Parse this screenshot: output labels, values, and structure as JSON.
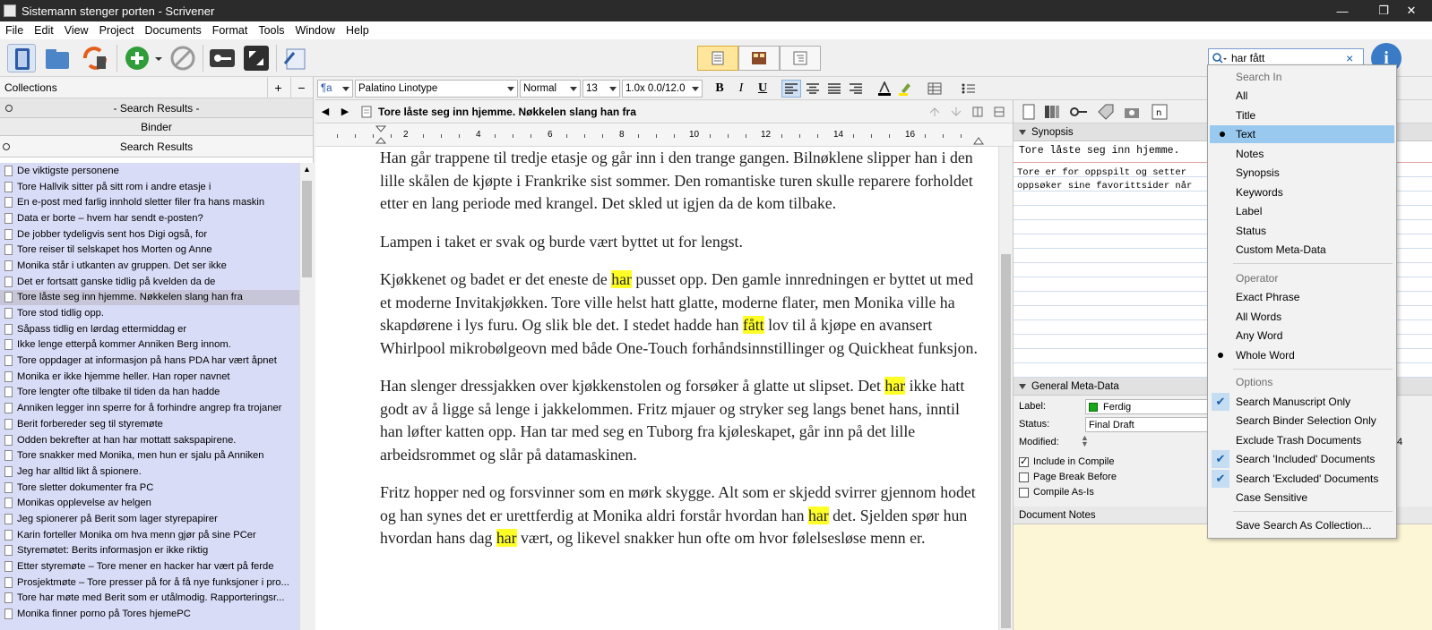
{
  "window": {
    "title": "Sistemann stenger porten - Scrivener",
    "minimize": "—",
    "maximize": "❐",
    "close": "✕"
  },
  "menu": [
    "File",
    "Edit",
    "View",
    "Project",
    "Documents",
    "Format",
    "Tools",
    "Window",
    "Help"
  ],
  "toolbar": {
    "search_value": "har fått",
    "search_clear": "×",
    "help_label": "i"
  },
  "binder": {
    "collections_label": "Collections",
    "add_label": "+",
    "remove_label": "−",
    "search_results_tab": "- Search Results -",
    "binder_tab": "Binder",
    "search_results_header": "Search Results",
    "items": [
      "De viktigste personene",
      "Tore Hallvik sitter på sitt rom i andre etasje i",
      "En e-post med farlig innhold sletter filer fra hans maskin",
      "Data er borte – hvem har sendt e-posten?",
      "De jobber tydeligvis sent hos Digi også, for",
      "Tore reiser til selskapet hos Morten og Anne",
      "Monika står i utkanten av gruppen. Det ser ikke",
      "Det er fortsatt ganske tidlig på kvelden da de",
      "Tore låste seg inn hjemme. Nøkkelen slang han fra",
      "Tore stod tidlig opp.",
      "Såpass tidlig en lørdag ettermiddag er",
      "Ikke lenge etterpå kommer Anniken Berg innom.",
      "Tore oppdager at informasjon på hans PDA har vært åpnet",
      "Monika er ikke hjemme heller. Han roper navnet",
      "Tore lengter ofte tilbake til tiden da han hadde",
      "Anniken legger inn sperre for å forhindre angrep fra trojaner",
      "Berit forbereder seg til styremøte",
      "Odden bekrefter at han har mottatt sakspapirene.",
      "Tore snakker med Monika, men hun er sjalu på Anniken",
      "Jeg har alltid likt å spionere.",
      "Tore sletter dokumenter fra PC",
      "Monikas opplevelse av helgen",
      "Jeg spionerer på Berit som lager styrepapirer",
      "Karin forteller Monika om hva menn gjør på sine PCer",
      "Styremøtet: Berits informasjon er ikke riktig",
      "Etter styremøte – Tore mener en hacker har vært på ferde",
      "Prosjektmøte – Tore presser på for å få nye funksjoner i pro...",
      "Tore har møte med Berit som er utålmodig. Rapporteringsr...",
      "Monika finner porno på Tores hjemePC"
    ]
  },
  "format": {
    "style": "¶a",
    "font": "Palatino Linotype",
    "weight": "Normal",
    "size": "13",
    "spacing": "1.0x 0.0/12.0",
    "bold": "B",
    "italic": "I",
    "underline": "U"
  },
  "editor": {
    "title": "Tore låste seg inn hjemme. Nøkkelen slang han fra",
    "ruler": [
      "2",
      "4",
      "6",
      "8",
      "10",
      "12",
      "14",
      "16"
    ],
    "p1": "Han går trappene til tredje etasje og går inn i den trange gangen. Bilnøklene slipper han i den lille skålen de kjøpte i Frankrike sist sommer. Den romantiske turen skulle reparere forholdet etter en lang periode med krangel. Det skled ut igjen da de kom tilbake.",
    "p2": "Lampen i taket er svak og burde vært byttet ut for lengst.",
    "p3a": "Kjøkkenet og badet er det eneste de ",
    "p3h1": "har",
    "p3b": " pusset opp. Den gamle innredningen er byttet ut med et moderne Invitakjøkken. Tore ville helst hatt glatte, moderne flater, men Monika ville ha skapdørene i lys furu. Og slik ble det. I stedet hadde han ",
    "p3h2": "fått",
    "p3c": " lov til å kjøpe en avansert Whirlpool mikrobølgeovn med både One-Touch forhåndsinnstillinger og Quickheat funksjon.",
    "p4a": "Han slenger dressjakken over kjøkkenstolen og forsøker å glatte ut slipset. Det ",
    "p4h1": "har",
    "p4b": " ikke hatt godt av å ligge så lenge i jakkelommen. Fritz mjauer og stryker seg langs benet hans, inntil han løfter katten opp. Han tar med seg en Tuborg fra kjøleskapet, går inn på det lille arbeidsrommet og slår på datamaskinen.",
    "p5a": "Fritz hopper ned og forsvinner som en mørk skygge. Alt som er skjedd svirrer gjennom hodet og han synes det er urettferdig at Monika aldri forstår hvordan han ",
    "p5h1": "har",
    "p5b": " det. Sjelden spør hun hvordan hans dag ",
    "p5h2": "har",
    "p5c": " vært, og likevel snakker hun ofte om hvor følelsesløse menn er."
  },
  "inspector": {
    "synopsis_label": "Synopsis",
    "synopsis_title": "Tore låste seg inn hjemme.",
    "synopsis_body": "Tore er for oppspilt og setter\noppsøker sine favorittsider når",
    "meta_label": "General Meta-Data",
    "label_label": "Label:",
    "label_value": "Ferdig",
    "label_color": "#18a818",
    "status_label": "Status:",
    "status_value": "Final Draft",
    "modified_label": "Modified:",
    "modified_value": "4",
    "include_compile": "Include in Compile",
    "page_break": "Page Break Before",
    "compile_as_is": "Compile As-Is",
    "notes_label": "Document Notes"
  },
  "dropdown": {
    "search_in_label": "Search In",
    "search_in": [
      "All",
      "Title",
      "Text",
      "Notes",
      "Synopsis",
      "Keywords",
      "Label",
      "Status",
      "Custom Meta-Data"
    ],
    "selected_search_in": "Text",
    "operator_label": "Operator",
    "operators": [
      "Exact Phrase",
      "All Words",
      "Any Word",
      "Whole Word"
    ],
    "selected_operator": "Whole Word",
    "options_label": "Options",
    "options": [
      "Search Manuscript Only",
      "Search Binder Selection Only",
      "Exclude Trash Documents",
      "Search 'Included' Documents",
      "Search 'Excluded' Documents",
      "Case Sensitive"
    ],
    "checked_options": [
      "Search Manuscript Only",
      "Search 'Included' Documents",
      "Search 'Excluded' Documents"
    ],
    "save_label": "Save Search As Collection..."
  },
  "colors": {
    "highlight": "#ffff26",
    "binder_bg": "#d9dcf7",
    "menu_hover": "#99c9ef"
  }
}
